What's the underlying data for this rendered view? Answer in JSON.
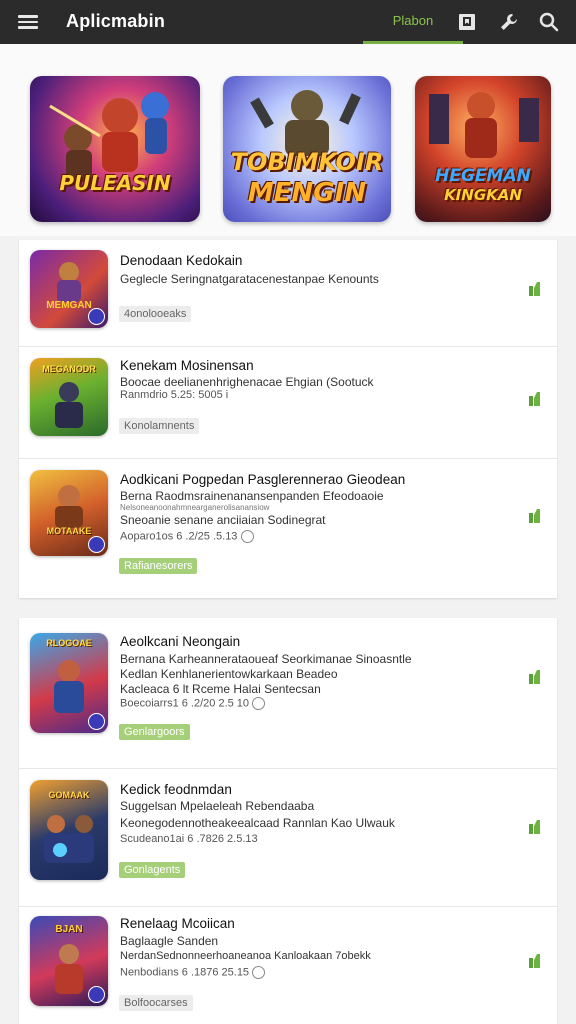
{
  "app": {
    "title": "Aplicmabin"
  },
  "topbar": {
    "active_tab_label": "Plabon"
  },
  "icons": {
    "menu": "menu-icon",
    "bookmark": "bookmark-icon",
    "wrench": "wrench-icon",
    "search": "search-icon",
    "download": "download-icon",
    "info": "info-icon"
  },
  "banners": [
    {
      "text": "PULEASIN"
    },
    {
      "text_line1": "TOBIMKOIR",
      "text_line2": "MENGIN"
    },
    {
      "text_line1": "HEGEMAN",
      "text_line2": "KINGKAN"
    }
  ],
  "list1": [
    {
      "title": "Denodaan Kedokain",
      "line1": "Geglecle Seringnatgaratacenestanpae Kenounts",
      "tag": "4onolooeaks",
      "thumb_text": "MEMGAN"
    },
    {
      "title": "Kenekam Mosinensan",
      "line1": "Boocae deelianenhrighenacae Ehgian (Sootuck",
      "line2": "Ranmdrio 5.25: 5005 i",
      "tag": "Konolamnents",
      "thumb_text": "MEGANODR"
    },
    {
      "title": "Aodkicani Pogpedan Pasglerennerao Gieodean",
      "line1": "Berna Raodmsrainenanansenpanden Efeodoaoie",
      "line2": "Nelsoneanoonahmnearganerolisanansiow",
      "line3": "Sneoanie senane anciiaian Sodinegrat",
      "meta": "Aoparo1os 6 .2/25 .5.13",
      "tag": "Rafianesorers",
      "tag_green": true,
      "thumb_text": "MOTAAKE"
    }
  ],
  "list2": [
    {
      "title": "Aeolkcani Neongain",
      "line1": "Bernana Karheannerataoueaf Seorkimanae Sinoasntle",
      "line2": "Kedlan Kenhlanerientowkarkaan Beadeo",
      "line3": "Kacleaca 6 lt Rceme Halai Sentecsan",
      "meta": "Boecoiarrs1 6 .2/20 2.5 10",
      "tag": "Genlargoors",
      "tag_green": true,
      "thumb_text": "RLOGOAE"
    },
    {
      "title": "Kedick feodnmdan",
      "line1": "Suggelsan Mpelaeleah Rebendaaba",
      "line2": "Keonegodennotheakeealcaad Rannlan Kao Ulwauk",
      "meta": "Scudeano1ai 6 .7826 2.5.13",
      "tag": "Gonlagents",
      "tag_green": true,
      "thumb_text": "GOMAAK"
    },
    {
      "title": "Renelaag Mcoiican",
      "line1": "Baglaagle Sanden",
      "line2": "NerdanSednonneerhoaneanoa Kanloakaan 7obekk",
      "meta": "Nenbodians 6 .1876 25.15",
      "tag": "Bolfoocarses",
      "thumb_text": "BJAN"
    }
  ]
}
